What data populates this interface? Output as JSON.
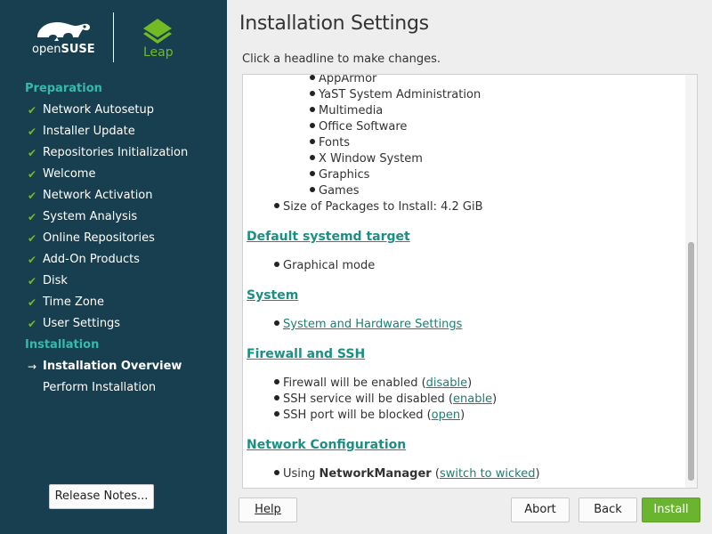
{
  "branding": {
    "opensuse_prefix": "open",
    "opensuse_suffix": "SUSE",
    "leap_label": "Leap",
    "accent_green": "#73ba25",
    "sidebar_bg": "#173f4f",
    "section_color": "#35b9ab"
  },
  "sidebar": {
    "sections": [
      {
        "label": "Preparation",
        "steps": [
          {
            "label": "Network Autosetup",
            "mark": "✔"
          },
          {
            "label": "Installer Update",
            "mark": "✔"
          },
          {
            "label": "Repositories Initialization",
            "mark": "✔"
          },
          {
            "label": "Welcome",
            "mark": "✔"
          },
          {
            "label": "Network Activation",
            "mark": "✔"
          },
          {
            "label": "System Analysis",
            "mark": "✔"
          },
          {
            "label": "Online Repositories",
            "mark": "✔"
          },
          {
            "label": "Add-On Products",
            "mark": "✔"
          },
          {
            "label": "Disk",
            "mark": "✔"
          },
          {
            "label": "Time Zone",
            "mark": "✔"
          },
          {
            "label": "User Settings",
            "mark": "✔"
          }
        ]
      },
      {
        "label": "Installation",
        "steps": [
          {
            "label": "Installation Overview",
            "mark": "→",
            "current": true
          },
          {
            "label": "Perform Installation",
            "mark": ""
          }
        ]
      }
    ],
    "release_notes_label": "Release Notes..."
  },
  "main": {
    "title": "Installation Settings",
    "subtitle": "Click a headline to make changes.",
    "patterns": [
      "AppArmor",
      "YaST System Administration",
      "Multimedia",
      "Office Software",
      "Fonts",
      "X Window System",
      "Graphics",
      "Games"
    ],
    "package_size": "Size of Packages to Install: 4.2 GiB",
    "systemd": {
      "heading": "Default systemd target",
      "value": "Graphical mode"
    },
    "system": {
      "heading": "System",
      "link": "System and Hardware Settings"
    },
    "firewall": {
      "heading": "Firewall and SSH",
      "fw_text": "Firewall will be enabled (",
      "fw_link": "disable",
      "ssh_text": "SSH service will be disabled (",
      "ssh_link": "enable",
      "port_text": "SSH port will be blocked (",
      "port_link": "open",
      "close_paren": ")"
    },
    "network": {
      "heading": "Network Configuration",
      "prefix": "Using ",
      "bold": "NetworkManager",
      "open_paren": " (",
      "link": "switch to wicked",
      "close_paren": ")"
    }
  },
  "buttons": {
    "help": "Help",
    "abort": "Abort",
    "back": "Back",
    "install": "Install"
  }
}
